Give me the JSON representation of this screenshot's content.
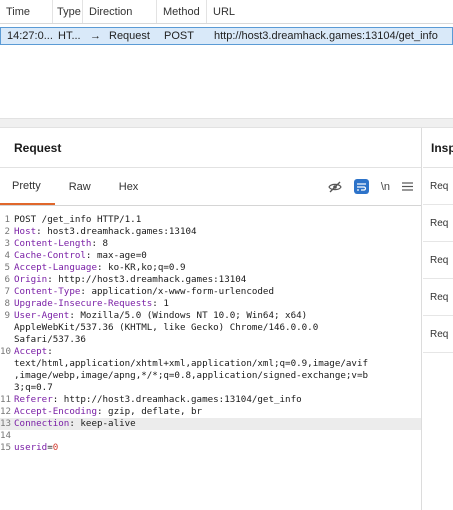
{
  "history": {
    "headers": {
      "time": "Time",
      "type": "Type",
      "direction": "Direction",
      "method": "Method",
      "url": "URL"
    },
    "rows": [
      {
        "time": "14:27:0...",
        "type": "HT...",
        "arrow": "→",
        "direction": "Request",
        "method": "POST",
        "url": "http://host3.dreamhack.games:13104/get_info"
      }
    ]
  },
  "request_panel": {
    "title": "Request",
    "tabs": [
      "Pretty",
      "Raw",
      "Hex"
    ],
    "icons": {
      "hide": "eye-slash-icon",
      "wrap": "word-wrap-icon",
      "newline_label": "\\n",
      "menu": "hamburger-menu-icon"
    },
    "lines": [
      {
        "n": "1",
        "key": "",
        "rest": "POST /get_info HTTP/1.1"
      },
      {
        "n": "2",
        "key": "Host",
        "rest": ": host3.dreamhack.games:13104"
      },
      {
        "n": "3",
        "key": "Content-Length",
        "rest": ": 8"
      },
      {
        "n": "4",
        "key": "Cache-Control",
        "rest": ": max-age=0"
      },
      {
        "n": "5",
        "key": "Accept-Language",
        "rest": ": ko-KR,ko;q=0.9"
      },
      {
        "n": "6",
        "key": "Origin",
        "rest": ": http://host3.dreamhack.games:13104"
      },
      {
        "n": "7",
        "key": "Content-Type",
        "rest": ": application/x-www-form-urlencoded"
      },
      {
        "n": "8",
        "key": "Upgrade-Insecure-Requests",
        "rest": ": 1"
      },
      {
        "n": "9",
        "key": "User-Agent",
        "rest": ": Mozilla/5.0 (Windows NT 10.0; Win64; x64)"
      },
      {
        "n": "",
        "key": "",
        "rest": "AppleWebKit/537.36 (KHTML, like Gecko) Chrome/146.0.0.0"
      },
      {
        "n": "",
        "key": "",
        "rest": "Safari/537.36"
      },
      {
        "n": "10",
        "key": "Accept",
        "rest": ":"
      },
      {
        "n": "",
        "key": "",
        "rest": "text/html,application/xhtml+xml,application/xml;q=0.9,image/avif"
      },
      {
        "n": "",
        "key": "",
        "rest": ",image/webp,image/apng,*/*;q=0.8,application/signed-exchange;v=b"
      },
      {
        "n": "",
        "key": "",
        "rest": "3;q=0.7"
      },
      {
        "n": "11",
        "key": "Referer",
        "rest": ": http://host3.dreamhack.games:13104/get_info"
      },
      {
        "n": "12",
        "key": "Accept-Encoding",
        "rest": ": gzip, deflate, br"
      },
      {
        "n": "13",
        "key": "Connection",
        "rest": ": keep-alive",
        "highlight": true
      },
      {
        "n": "14",
        "key": "",
        "rest": ""
      },
      {
        "n": "15",
        "key": "",
        "rest": "",
        "param_name": "userid",
        "param_eq": "=",
        "param_val": "0"
      }
    ]
  },
  "inspector": {
    "title": "Insp",
    "items": [
      "Req",
      "Req",
      "Req",
      "Req",
      "Req"
    ]
  }
}
